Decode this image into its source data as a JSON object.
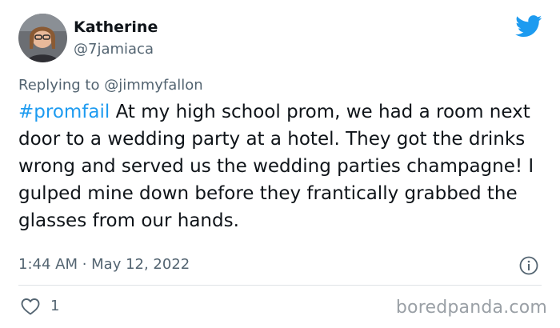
{
  "tweet": {
    "author_name": "Katherine",
    "author_handle": "@7jamiaca",
    "replying_prefix": "Replying to ",
    "replying_to": "@jimmyfallon",
    "hashtag": "#promfail",
    "text": " At my high school prom, we had a room next door to a wedding party at a hotel.  They got the drinks wrong and served us the wedding parties champagne!  I gulped mine down before they frantically grabbed the glasses from our hands.",
    "timestamp": "1:44 AM · May 12, 2022",
    "like_count": "1"
  },
  "icons": {
    "brand": "twitter-bird-icon",
    "info": "info-icon",
    "like": "heart-icon"
  },
  "watermark": "boredpanda.com",
  "colors": {
    "link": "#1d9bf0",
    "secondary_text": "#536471",
    "primary_text": "#0f1419",
    "divider": "#dfe3e6",
    "watermark": "#9aa0a6"
  }
}
